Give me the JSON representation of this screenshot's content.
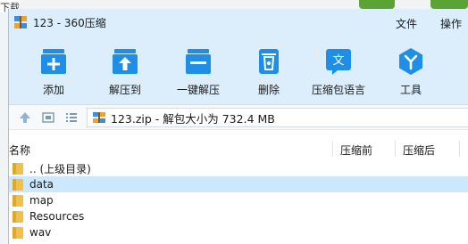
{
  "background": {
    "download_label": "下载"
  },
  "window": {
    "title": "123 - 360压缩",
    "menu": [
      {
        "label": "文件"
      },
      {
        "label": "操作"
      }
    ]
  },
  "toolbar": {
    "items": [
      {
        "label": "添加",
        "icon": "add-icon"
      },
      {
        "label": "解压到",
        "icon": "extract-to-icon"
      },
      {
        "label": "一键解压",
        "icon": "one-click-extract-icon"
      },
      {
        "label": "删除",
        "icon": "delete-icon"
      },
      {
        "label": "压缩包语言",
        "icon": "archive-language-icon"
      },
      {
        "label": "工具",
        "icon": "tools-icon"
      }
    ]
  },
  "address": {
    "text": "123.zip - 解包大小为 732.4 MB"
  },
  "columns": {
    "name": "名称",
    "before": "压缩前",
    "after": "压缩后"
  },
  "files": [
    {
      "name": ".. (上级目录)"
    },
    {
      "name": "data",
      "selected": true
    },
    {
      "name": "map"
    },
    {
      "name": "Resources"
    },
    {
      "name": "wav"
    }
  ],
  "colors": {
    "accent": "#1e8ee6",
    "titlebar": "#dceefc",
    "selection": "#cce8ff",
    "folder": "#f0c04a"
  }
}
